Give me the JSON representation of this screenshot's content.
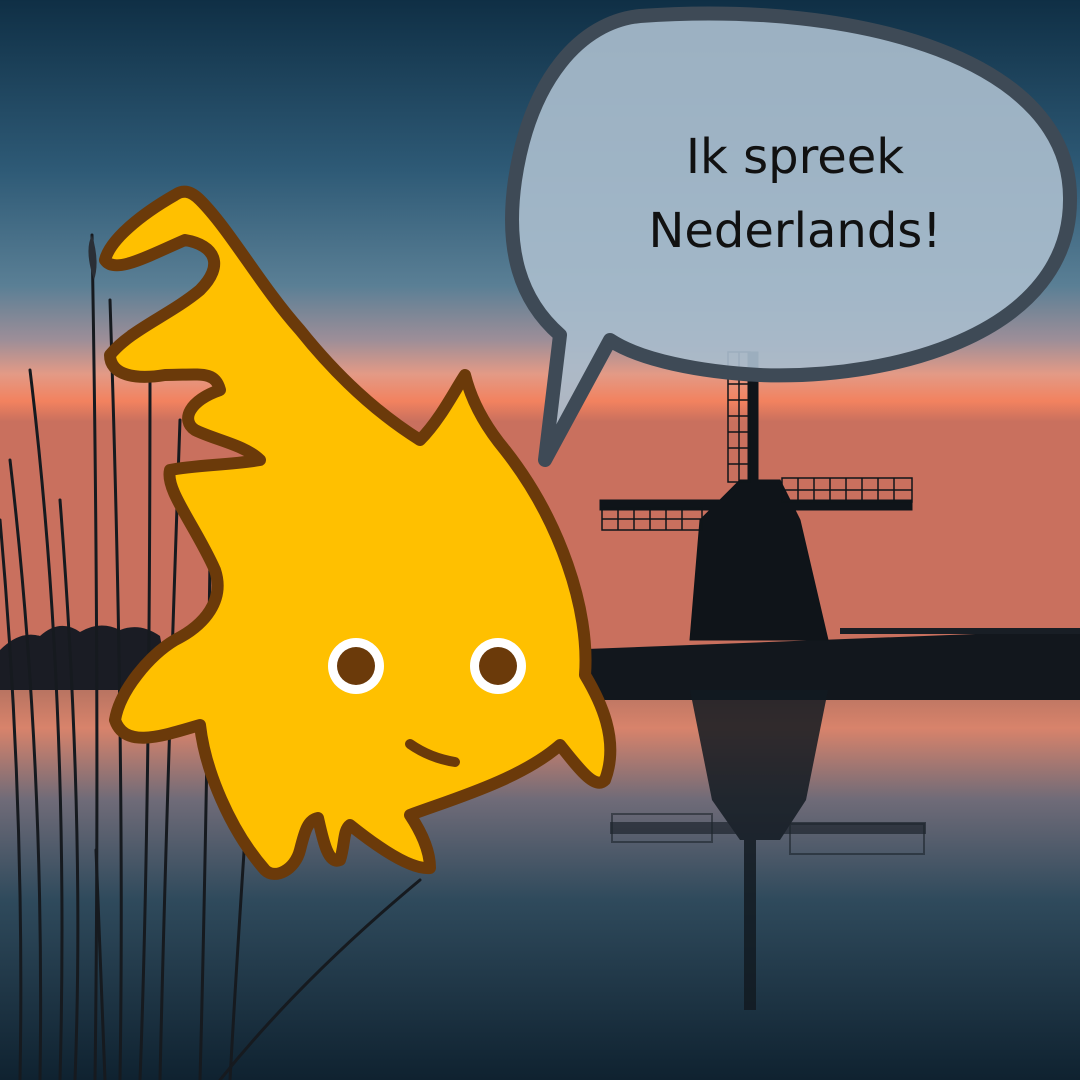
{
  "speech_bubble": {
    "line1": "Ik spreek",
    "line2": "Nederlands!"
  },
  "scene": {
    "subject": "windmill-silhouette",
    "character": "yellow-flame-mascot"
  },
  "colors": {
    "sky_top": "#13384f",
    "sky_mid": "#3d6a86",
    "sky_glow": "#f08c6a",
    "water": "#1f3a4a",
    "mascot_fill": "#ffc000",
    "mascot_outline": "#6b3a0a",
    "bubble_fill": "#a9bccb",
    "bubble_outline": "#3f4a55",
    "silhouette": "#101820"
  }
}
